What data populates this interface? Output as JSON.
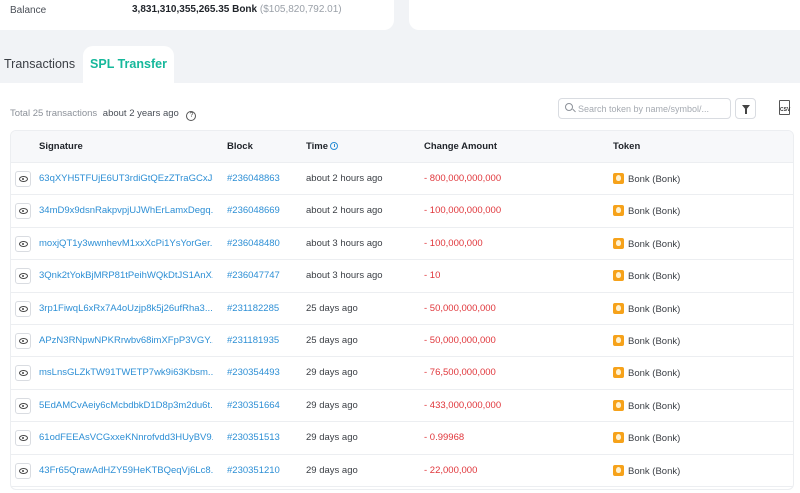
{
  "balance": {
    "label": "Balance",
    "value": "3,831,310,355,265.35 Bonk",
    "usd": "($105,820,792.01)"
  },
  "tabs": [
    {
      "label": "Transactions",
      "active": false
    },
    {
      "label": "SPL Transfer",
      "active": true
    }
  ],
  "summary": {
    "total": "Total 25 transactions",
    "ago": "about 2 years ago"
  },
  "search": {
    "placeholder": "Search token by name/symbol/..."
  },
  "icons": {
    "search": "search-icon",
    "filter": "filter-icon",
    "csv": "csv-download-icon",
    "eye": "eye-icon",
    "clock": "clock-icon",
    "token": "bonk-token-icon",
    "help": "help-icon"
  },
  "colors": {
    "accent": "#16b89b",
    "link": "#2d8fd5",
    "negative": "#e0363b"
  },
  "table": {
    "headers": {
      "signature": "Signature",
      "block": "Block",
      "time": "Time",
      "change": "Change Amount",
      "token": "Token"
    },
    "rows": [
      {
        "sig": "63qXYH5TFUjE6UT3rdiGtQEzZTraGCxJ5...",
        "block": "#236048863",
        "time": "about 2 hours ago",
        "amount": "- 800,000,000,000",
        "token": "Bonk (Bonk)"
      },
      {
        "sig": "34mD9x9dsnRakpvpjUJWhErLamxDegq...",
        "block": "#236048669",
        "time": "about 2 hours ago",
        "amount": "- 100,000,000,000",
        "token": "Bonk (Bonk)"
      },
      {
        "sig": "moxjQT1y3wwnhevM1xxXcPi1YsYorGer...",
        "block": "#236048480",
        "time": "about 3 hours ago",
        "amount": "- 100,000,000",
        "token": "Bonk (Bonk)"
      },
      {
        "sig": "3Qnk2tYokBjMRP81tPeihWQkDtJS1AnX...",
        "block": "#236047747",
        "time": "about 3 hours ago",
        "amount": "- 10",
        "token": "Bonk (Bonk)"
      },
      {
        "sig": "3rp1FiwqL6xRx7A4oUzjp8k5j26ufRha3...",
        "block": "#231182285",
        "time": "25 days ago",
        "amount": "- 50,000,000,000",
        "token": "Bonk (Bonk)"
      },
      {
        "sig": "APzN3RNpwNPKRrwbv68imXFpP3VGY...",
        "block": "#231181935",
        "time": "25 days ago",
        "amount": "- 50,000,000,000",
        "token": "Bonk (Bonk)"
      },
      {
        "sig": "msLnsGLZkTW91TWETP7wk9i63Kbsm...",
        "block": "#230354493",
        "time": "29 days ago",
        "amount": "- 76,500,000,000",
        "token": "Bonk (Bonk)"
      },
      {
        "sig": "5EdAMCvAeiy6cMcbdbkD1D8p3m2du6t...",
        "block": "#230351664",
        "time": "29 days ago",
        "amount": "- 433,000,000,000",
        "token": "Bonk (Bonk)"
      },
      {
        "sig": "61odFEEAsVCGxxeKNnrofvdd3HUyBV9...",
        "block": "#230351513",
        "time": "29 days ago",
        "amount": "- 0.99968",
        "token": "Bonk (Bonk)"
      },
      {
        "sig": "43Fr65QrawAdHZY59HeKTBQeqVj6Lc8...",
        "block": "#230351210",
        "time": "29 days ago",
        "amount": "- 22,000,000",
        "token": "Bonk (Bonk)"
      }
    ]
  }
}
